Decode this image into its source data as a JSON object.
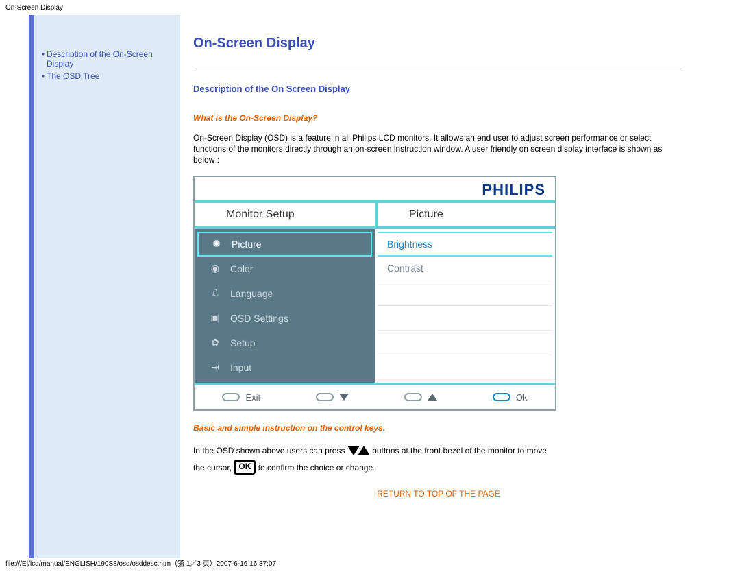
{
  "page": {
    "title_top": "On-Screen Display",
    "footer_path": "file:///E|/lcd/manual/ENGLISH/190S8/osd/osddesc.htm（第 1／3 页）2007-6-16 16:37:07"
  },
  "sidebar": {
    "items": [
      {
        "label": "Description of the On-Screen Display"
      },
      {
        "label": "The OSD Tree"
      }
    ]
  },
  "main": {
    "h1": "On-Screen Display",
    "h2": "Description of the On Screen Display",
    "emph1": "What is the On-Screen Display?",
    "para1": "On-Screen Display (OSD) is a feature in all Philips LCD monitors. It allows an end user to adjust screen performance or select functions of the monitors directly through an on-screen instruction window. A user friendly on screen display interface is shown as below :",
    "emph2": "Basic and simple instruction on the control keys.",
    "para2a": "In the OSD shown above users can press",
    "para2b": "buttons at the front bezel of the monitor to move",
    "para2c": "the cursor,",
    "para2d": "to confirm the choice or change.",
    "ok_inline": "OK",
    "return": "RETURN TO TOP OF THE PAGE"
  },
  "osd": {
    "logo": "PHILIPS",
    "header_left": "Monitor Setup",
    "header_right": "Picture",
    "left_items": [
      {
        "icon": "✺",
        "label": "Picture",
        "active": true
      },
      {
        "icon": "◉",
        "label": "Color"
      },
      {
        "icon": "ℒ",
        "label": "Language"
      },
      {
        "icon": "▣",
        "label": "OSD Settings"
      },
      {
        "icon": "✿",
        "label": "Setup"
      },
      {
        "icon": "⇥",
        "label": "Input"
      }
    ],
    "right_items": [
      {
        "label": "Brightness",
        "active": true
      },
      {
        "label": "Contrast"
      },
      {
        "label": ""
      },
      {
        "label": ""
      },
      {
        "label": ""
      },
      {
        "label": ""
      }
    ],
    "bottom": {
      "exit": "Exit",
      "ok": "Ok"
    }
  }
}
